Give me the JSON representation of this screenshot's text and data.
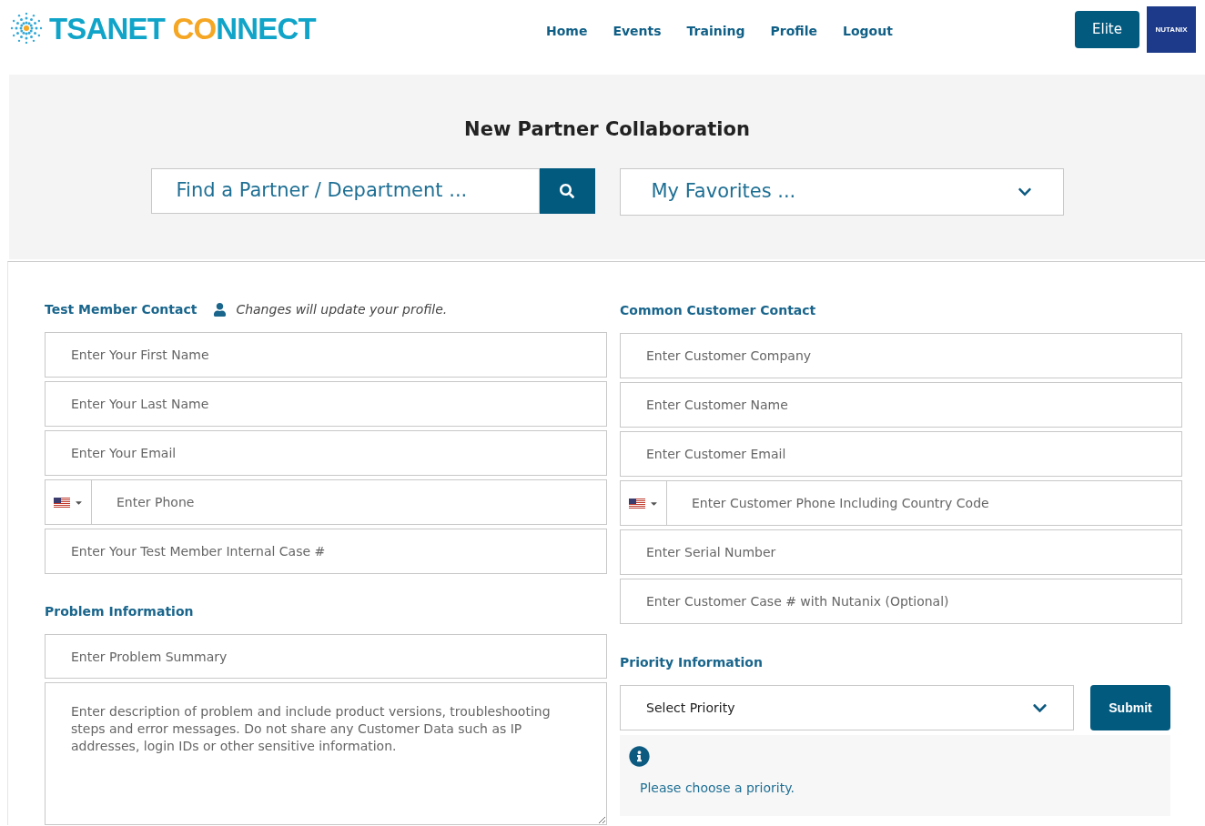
{
  "logo": {
    "name": "TSANET",
    "accent": "CO",
    "rest": "NNECT"
  },
  "nav": [
    {
      "label": "Home"
    },
    {
      "label": "Events"
    },
    {
      "label": "Training"
    },
    {
      "label": "Profile"
    },
    {
      "label": "Logout"
    }
  ],
  "tier_button": "Elite",
  "partner_logo": "NUTANIX",
  "page_title": "New Partner Collaboration",
  "partner_search": {
    "placeholder": "Find a Partner / Department ..."
  },
  "favorites": {
    "placeholder": "My Favorites ..."
  },
  "member_contact": {
    "heading": "Test Member Contact",
    "note": "Changes will update your profile.",
    "fields": [
      {
        "kind": "text",
        "placeholder": "Enter Your First Name"
      },
      {
        "kind": "text",
        "placeholder": "Enter Your Last Name"
      },
      {
        "kind": "text",
        "placeholder": "Enter Your Email"
      },
      {
        "kind": "phone",
        "placeholder": "Enter Phone"
      },
      {
        "kind": "text",
        "placeholder": "Enter Your Test Member Internal Case #"
      }
    ]
  },
  "problem": {
    "heading": "Problem Information",
    "summary": {
      "placeholder": "Enter Problem Summary"
    },
    "description": {
      "placeholder": "Enter description of problem and include product versions, troubleshooting steps and error messages. Do not share any Customer Data such as IP addresses, login IDs or other sensitive information."
    }
  },
  "customer_contact": {
    "heading": "Common Customer Contact",
    "fields": [
      {
        "kind": "text",
        "placeholder": "Enter Customer Company"
      },
      {
        "kind": "text",
        "placeholder": "Enter Customer Name"
      },
      {
        "kind": "text",
        "placeholder": "Enter Customer Email"
      },
      {
        "kind": "phone",
        "placeholder": "Enter Customer Phone Including Country Code"
      },
      {
        "kind": "text",
        "placeholder": "Enter Serial Number"
      },
      {
        "kind": "text",
        "placeholder": "Enter Customer Case # with Nutanix (Optional)"
      }
    ]
  },
  "priority": {
    "heading": "Priority Information",
    "select": "Select Priority",
    "submit": "Submit",
    "message": "Please choose a priority."
  }
}
